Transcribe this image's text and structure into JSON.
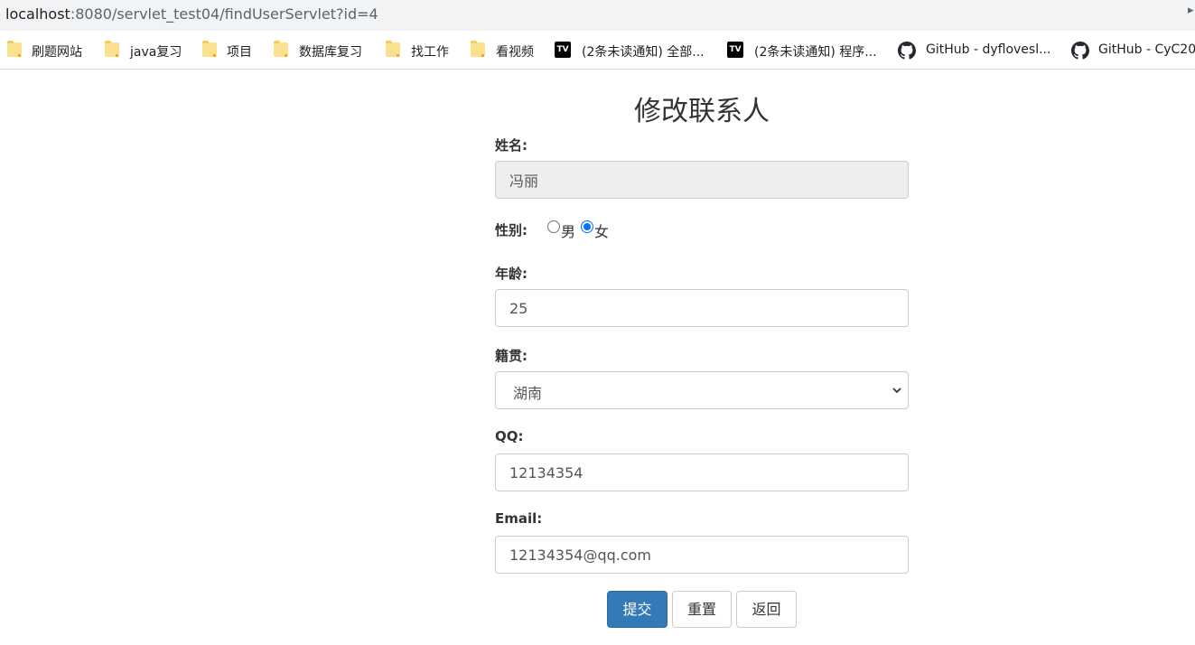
{
  "browser": {
    "url_host": "localhost",
    "url_path": ":8080/servlet_test04/findUserServlet?id=4",
    "bookmarks": [
      {
        "label": "刷题网站",
        "icon": "folder-icon"
      },
      {
        "label": "java复习",
        "icon": "folder-icon"
      },
      {
        "label": "项目",
        "icon": "folder-icon"
      },
      {
        "label": "数据库复习",
        "icon": "folder-icon"
      },
      {
        "label": "找工作",
        "icon": "folder-icon"
      },
      {
        "label": "看视频",
        "icon": "folder-icon"
      },
      {
        "label": "(2条未读通知) 全部...",
        "icon": "bilibili-tv-icon"
      },
      {
        "label": "(2条未读通知) 程序...",
        "icon": "bilibili-tv-icon"
      },
      {
        "label": "GitHub - dyflovesl...",
        "icon": "github-icon"
      },
      {
        "label": "GitHub - CyC20",
        "icon": "github-icon"
      }
    ]
  },
  "form": {
    "title": "修改联系人",
    "name_label": "姓名:",
    "name_value": "冯丽",
    "gender_label": "性别:",
    "gender_male": "男",
    "gender_female": "女",
    "gender_selected": "女",
    "age_label": "年龄:",
    "age_value": "25",
    "origin_label": "籍贯:",
    "origin_value": "湖南",
    "qq_label": "QQ:",
    "qq_value": "12134354",
    "email_label": "Email:",
    "email_value": "12134354@qq.com",
    "submit_label": "提交",
    "reset_label": "重置",
    "back_label": "返回"
  },
  "colors": {
    "primary": "#337ab7",
    "radio_accent": "#0075ff",
    "readonly_bg": "#eeeeee"
  }
}
